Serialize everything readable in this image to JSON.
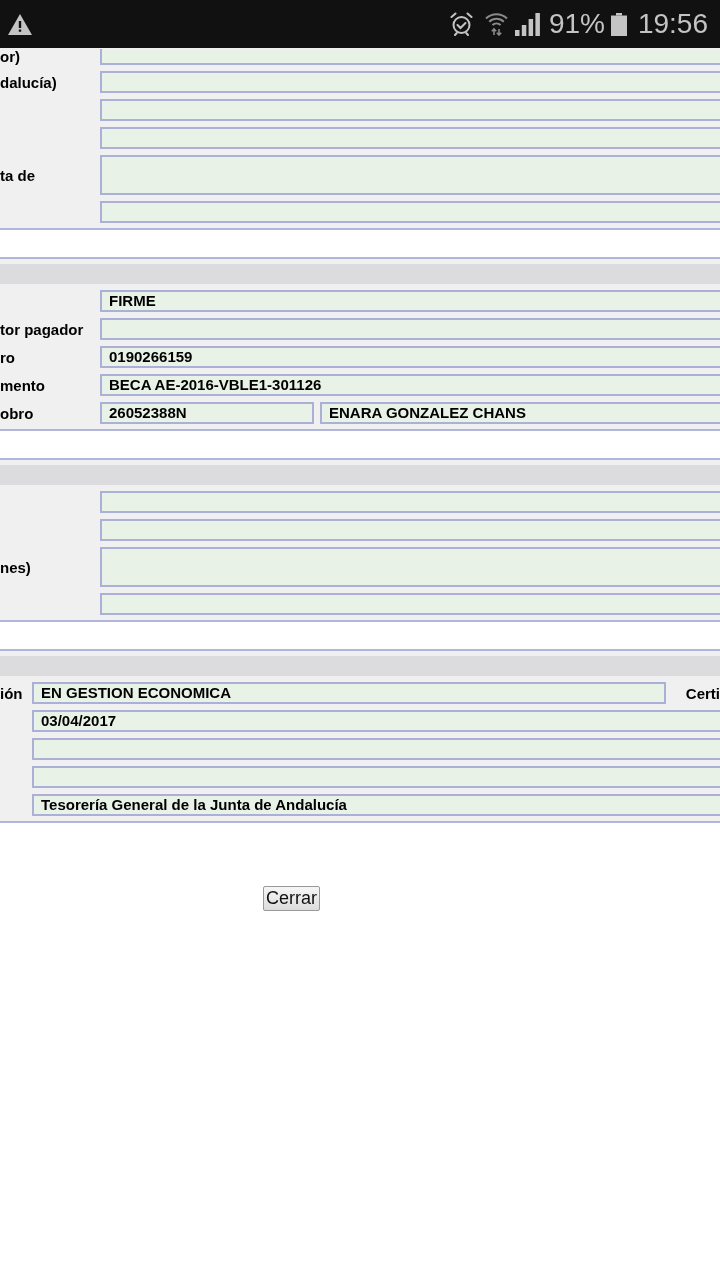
{
  "status_bar": {
    "battery": "91%",
    "time": "19:56"
  },
  "sections": [
    {
      "header_bar": false,
      "rows": [
        {
          "label": "or)",
          "fields": [
            {
              "kind": "input"
            }
          ]
        },
        {
          "label": "dalucía)",
          "fields": [
            {
              "kind": "input"
            }
          ]
        },
        {
          "fields": [
            {
              "kind": "input"
            }
          ]
        },
        {
          "fields": [
            {
              "kind": "input"
            }
          ]
        },
        {
          "label": "ta de",
          "fields": [
            {
              "kind": "textarea"
            }
          ]
        },
        {
          "fields": [
            {
              "kind": "input"
            }
          ]
        }
      ]
    },
    {
      "header_bar": true,
      "rows": [
        {
          "fields": [
            {
              "kind": "input",
              "value": "FIRME"
            }
          ]
        },
        {
          "label": "tor pagador",
          "fields": [
            {
              "kind": "input"
            }
          ]
        },
        {
          "label": "ro",
          "fields": [
            {
              "kind": "input",
              "value": "0190266159"
            }
          ]
        },
        {
          "label": "mento",
          "fields": [
            {
              "kind": "input",
              "value": "BECA AE-2016-VBLE1-301126"
            }
          ]
        },
        {
          "label": "obro",
          "fields": [
            {
              "kind": "input",
              "value": "26052388N"
            },
            {
              "kind": "input",
              "value": "ENARA GONZALEZ CHANS"
            }
          ]
        }
      ]
    },
    {
      "header_bar": true,
      "rows": [
        {
          "fields": [
            {
              "kind": "input"
            }
          ]
        },
        {
          "fields": [
            {
              "kind": "input"
            }
          ]
        },
        {
          "label": "nes)",
          "fields": [
            {
              "kind": "textarea"
            }
          ]
        },
        {
          "fields": [
            {
              "kind": "input"
            }
          ]
        }
      ]
    },
    {
      "header_bar": true,
      "rows": [
        {
          "label": "ión",
          "fields": [
            {
              "kind": "input",
              "value": "EN GESTION ECONOMICA"
            }
          ],
          "side_label": "Certi"
        },
        {
          "fields": [
            {
              "kind": "input",
              "value": "03/04/2017"
            }
          ]
        },
        {
          "fields": [
            {
              "kind": "input"
            }
          ]
        },
        {
          "fields": [
            {
              "kind": "input"
            }
          ]
        },
        {
          "fields": [
            {
              "kind": "input",
              "value": "Tesorería General de la Junta de Andalucía"
            }
          ]
        }
      ]
    }
  ],
  "close_button": "Cerrar"
}
